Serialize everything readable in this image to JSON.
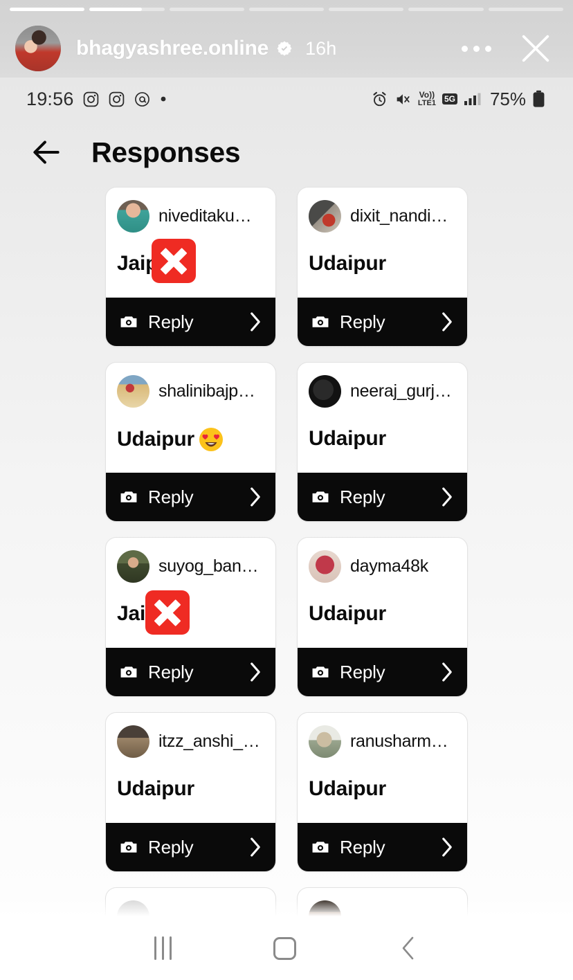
{
  "story": {
    "account": "bhagyashree.online",
    "time_ago": "16h",
    "verified_icon": "verified-badge-icon",
    "more_icon": "more-options-icon",
    "close_icon": "close-icon",
    "avatar_icon": "story-avatar",
    "progress_segments": [
      100,
      70,
      0,
      0,
      0,
      0,
      0
    ]
  },
  "status_bar": {
    "time": "19:56",
    "left_icons": [
      "instagram-icon",
      "instagram-icon",
      "mention-icon",
      "dot-icon"
    ],
    "right_icons": [
      "alarm-icon",
      "mute-icon",
      "volte-icon",
      "5g-icon",
      "signal-icon"
    ],
    "volte_label": "Vo)) LTE1",
    "network_label": "5G",
    "battery": "75%"
  },
  "page": {
    "back_icon": "back-arrow-icon",
    "title": "Responses"
  },
  "responses": [
    {
      "username": "niveditaku…",
      "text": "Jaip",
      "emoji": "cross-mark-emoji",
      "reply_label": "Reply",
      "avatar": "avatar-nivedita"
    },
    {
      "username": "dixit_nandi…",
      "text": "Udaipur",
      "emoji": "",
      "reply_label": "Reply",
      "avatar": "avatar-dixit"
    },
    {
      "username": "shalinibajp…",
      "text": "Udaipur",
      "emoji": "heart-eyes-emoji",
      "reply_label": "Reply",
      "avatar": "avatar-shalini"
    },
    {
      "username": "neeraj_gurj…",
      "text": "Udaipur",
      "emoji": "",
      "reply_label": "Reply",
      "avatar": "avatar-neeraj"
    },
    {
      "username": "suyog_ban…",
      "text": "Jai",
      "emoji": "cross-mark-emoji",
      "reply_label": "Reply",
      "avatar": "avatar-suyog"
    },
    {
      "username": "dayma48k",
      "text": "Udaipur",
      "emoji": "",
      "reply_label": "Reply",
      "avatar": "avatar-dayma"
    },
    {
      "username": "itzz_anshi_…",
      "text": "Udaipur",
      "emoji": "",
      "reply_label": "Reply",
      "avatar": "avatar-itzz"
    },
    {
      "username": "ranusharm…",
      "text": "Udaipur",
      "emoji": "",
      "reply_label": "Reply",
      "avatar": "avatar-ranu"
    }
  ],
  "nav_bar": {
    "recents_icon": "recents-icon",
    "home_icon": "home-icon",
    "back_icon": "nav-back-icon"
  },
  "colors": {
    "reply_bar": "#0a0a0a",
    "cross_emoji": "#ef2b23",
    "header_band": "#d6d6d6",
    "card_border": "#e2e2e2"
  }
}
